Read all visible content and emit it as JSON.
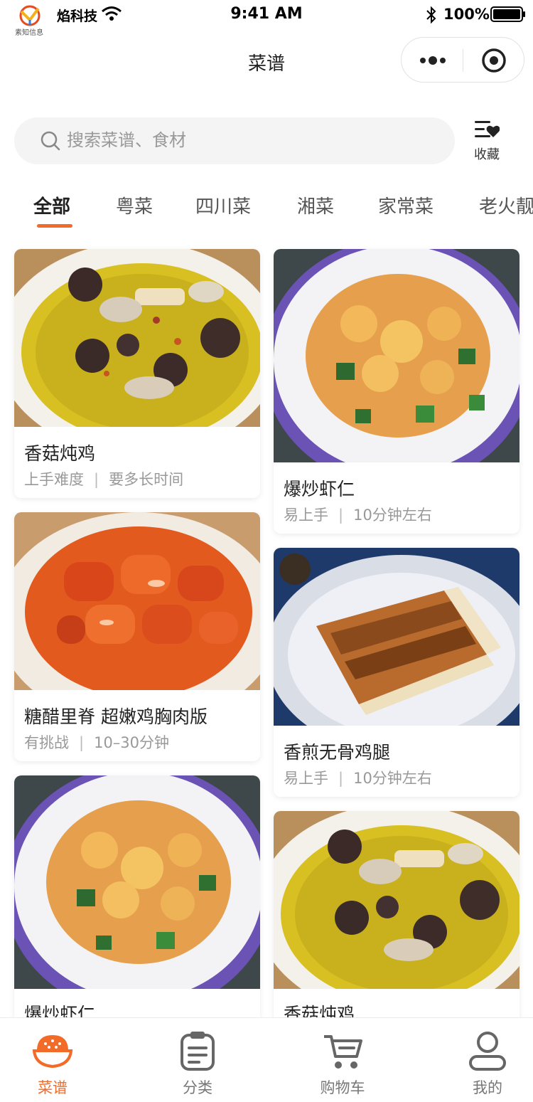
{
  "status_bar": {
    "carrier": "焰科技",
    "time": "9:41 AM",
    "battery": "100%",
    "logo_text": "素知信息"
  },
  "nav": {
    "title": "菜谱"
  },
  "search": {
    "placeholder": "搜索菜谱、食材"
  },
  "favorite": {
    "label": "收藏"
  },
  "tabs": [
    "全部",
    "粤菜",
    "四川菜",
    "湘菜",
    "家常菜",
    "老火靓"
  ],
  "recipes": [
    {
      "name": "香菇炖鸡",
      "difficulty": "上手难度",
      "time": "要多长时间",
      "image": "mushroom-chicken-soup"
    },
    {
      "name": "爆炒虾仁",
      "difficulty": "易上手",
      "time": "10分钟左右",
      "image": "stir-fried-shrimp"
    },
    {
      "name": "糖醋里脊 超嫩鸡胸肉版",
      "difficulty": "有挑战",
      "time": "10–30分钟",
      "image": "sweet-sour-pork"
    },
    {
      "name": "香煎无骨鸡腿",
      "difficulty": "易上手",
      "time": "10分钟左右",
      "image": "pan-fried-chicken"
    },
    {
      "name": "爆炒虾仁",
      "difficulty": "",
      "time": "",
      "image": "stir-fried-shrimp"
    },
    {
      "name": "香菇炖鸡",
      "difficulty": "",
      "time": "",
      "image": "mushroom-chicken-soup"
    }
  ],
  "tab_bar": {
    "items": [
      {
        "label": "菜谱",
        "icon": "rice-bowl-icon"
      },
      {
        "label": "分类",
        "icon": "clipboard-icon"
      },
      {
        "label": "购物车",
        "icon": "cart-icon"
      },
      {
        "label": "我的",
        "icon": "user-icon"
      }
    ]
  },
  "colors": {
    "accent": "#f26b28",
    "text": "#222222",
    "muted": "#999999"
  }
}
